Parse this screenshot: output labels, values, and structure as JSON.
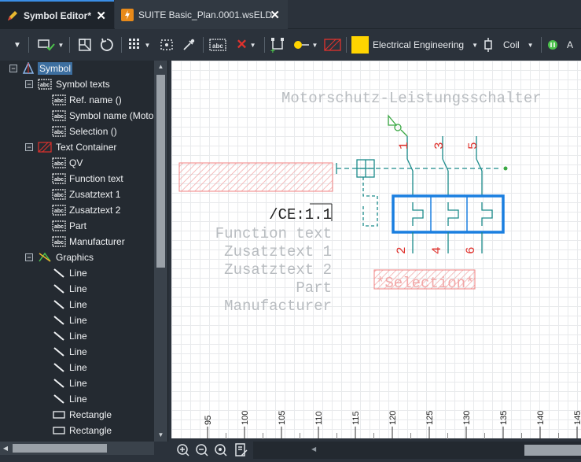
{
  "tabs": [
    {
      "label": "Symbol Editor*",
      "active": true
    },
    {
      "label": "SUITE Basic_Plan.0001.wsELD",
      "active": false
    }
  ],
  "toolbar": {
    "discipline": "Electrical Engineering",
    "component": "Coil",
    "text_tool": "A",
    "color_swatch": "#ffd400"
  },
  "tree": {
    "root": "Symbol",
    "groups": [
      {
        "label": "Symbol texts",
        "items": [
          "Ref. name ()",
          "Symbol name (Motorsc",
          "Selection ()"
        ]
      },
      {
        "label": "Text Container",
        "items": [
          "QV",
          "Function text",
          "Zusatztext 1",
          "Zusatztext 2",
          "Part",
          "Manufacturer"
        ]
      },
      {
        "label": "Graphics",
        "items": [
          "Line",
          "Line",
          "Line",
          "Line",
          "Line",
          "Line",
          "Line",
          "Line",
          "Line",
          "Rectangle",
          "Rectangle"
        ]
      }
    ]
  },
  "canvas": {
    "symbol_name": "Motorschutz-Leistungsschalter",
    "ce_label": "/CE:1.1",
    "texts": [
      "Function text",
      "Zusatztext 1",
      "Zusatztext 2",
      "Part",
      "Manufacturer"
    ],
    "selection": "*Selection*",
    "pins_top": [
      "1",
      "3",
      "5"
    ],
    "pins_bottom": [
      "2",
      "4",
      "6"
    ]
  },
  "ruler": {
    "ticks": [
      "95",
      "100",
      "105",
      "110",
      "115",
      "120",
      "125",
      "130",
      "135",
      "140",
      "145"
    ]
  },
  "colors": {
    "accent": "#1a7fe0",
    "red": "#e0322d",
    "green": "#3aa843",
    "bg_dark": "#2b323b"
  }
}
